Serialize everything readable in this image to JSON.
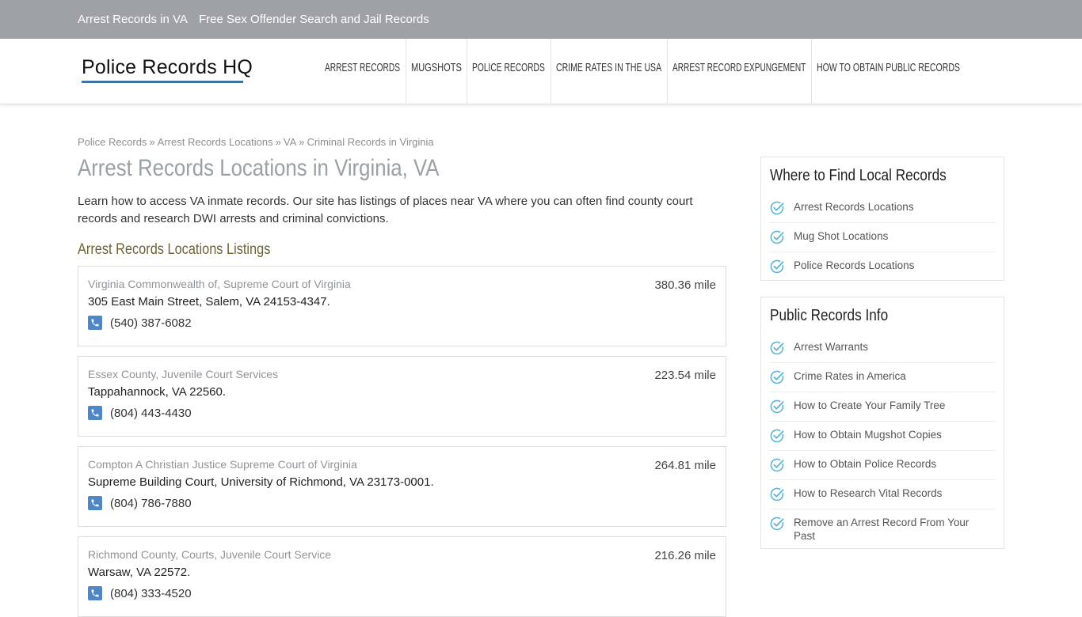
{
  "topbar": {
    "links": [
      "Arrest Records in VA",
      "Free Sex Offender Search and Jail Records"
    ]
  },
  "header": {
    "logo": "Police Records HQ",
    "nav": [
      "ARREST RECORDS",
      "MUGSHOTS",
      "POLICE RECORDS",
      "CRIME RATES IN THE USA",
      "ARREST RECORD EXPUNGEMENT",
      "HOW TO OBTAIN PUBLIC RECORDS"
    ]
  },
  "breadcrumb": {
    "items": [
      "Police Records",
      "Arrest Records Locations",
      "VA",
      "Criminal Records in Virginia"
    ],
    "separator": "»"
  },
  "main": {
    "title": "Arrest Records Locations in Virginia, VA",
    "intro": "Learn how to access VA inmate records. Our site has listings of places near VA where you can often find county court records and research DWI arrests and criminal convictions.",
    "listings_title": "Arrest Records Locations Listings",
    "listings": [
      {
        "name": "Virginia Commonwealth of, Supreme Court of Virginia",
        "distance": "380.36 mile",
        "address": "305 East Main Street, Salem, VA 24153-4347.",
        "phone": "(540) 387-6082"
      },
      {
        "name": "Essex County, Juvenile Court Services",
        "distance": "223.54 mile",
        "address": "Tappahannock, VA 22560.",
        "phone": "(804) 443-4430"
      },
      {
        "name": "Compton A Christian Justice Supreme Court of Virginia",
        "distance": "264.81 mile",
        "address": "Supreme Building Court, University of Richmond, VA 23173-0001.",
        "phone": "(804) 786-7880"
      },
      {
        "name": "Richmond County, Courts, Juvenile Court Service",
        "distance": "216.26 mile",
        "address": "Warsaw, VA 22572.",
        "phone": "(804) 333-4520"
      }
    ]
  },
  "sidebar": {
    "widgets": [
      {
        "title": "Where to Find Local Records",
        "items": [
          "Arrest Records Locations",
          "Mug Shot Locations",
          "Police Records Locations"
        ]
      },
      {
        "title": "Public Records Info",
        "items": [
          "Arrest Warrants",
          "Crime Rates in America",
          "How to Create Your Family Tree",
          "How to Obtain Mugshot Copies",
          "How to Obtain Police Records",
          "How to Research Vital Records",
          "Remove an Arrest Record From Your Past"
        ]
      }
    ]
  },
  "colors": {
    "topbar": "#9ea1a5",
    "logo_underline": "#3f6fa0",
    "phone_icon": "#4f86c6",
    "check_icon": "#5bb6d6",
    "section_title": "#6e6335"
  },
  "icons": {
    "phone": "phone-icon",
    "check": "check-circle-icon"
  }
}
